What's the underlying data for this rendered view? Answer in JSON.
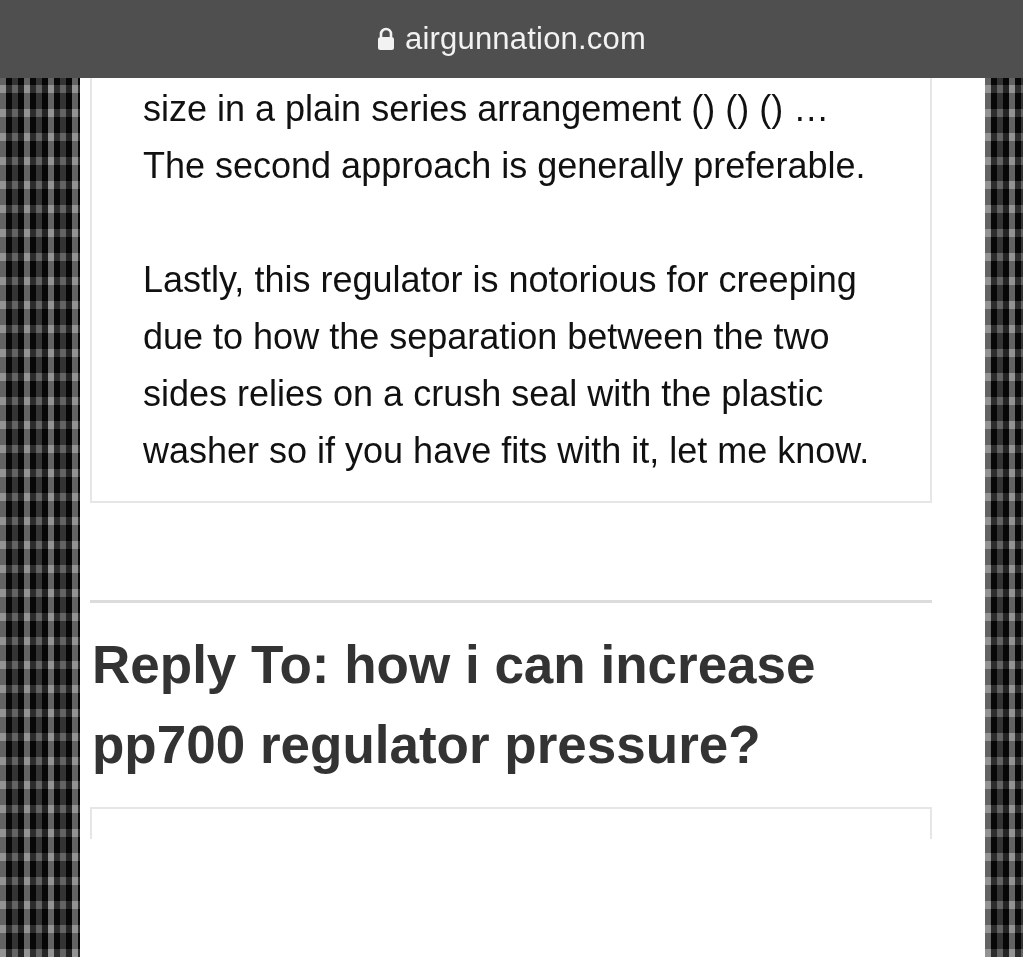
{
  "address_bar": {
    "url": "airgunnation.com"
  },
  "quote": {
    "paragraphs": [
      "size in a plain series arrangement () () () …  The second approach is generally preferable.",
      "Lastly, this regulator is notorious for creeping due to how the separation between the two sides relies on a crush seal with the plastic washer so if you have fits with it, let me know."
    ]
  },
  "reply": {
    "title": "Reply To: how i can increase pp700 regulator pressure?"
  }
}
